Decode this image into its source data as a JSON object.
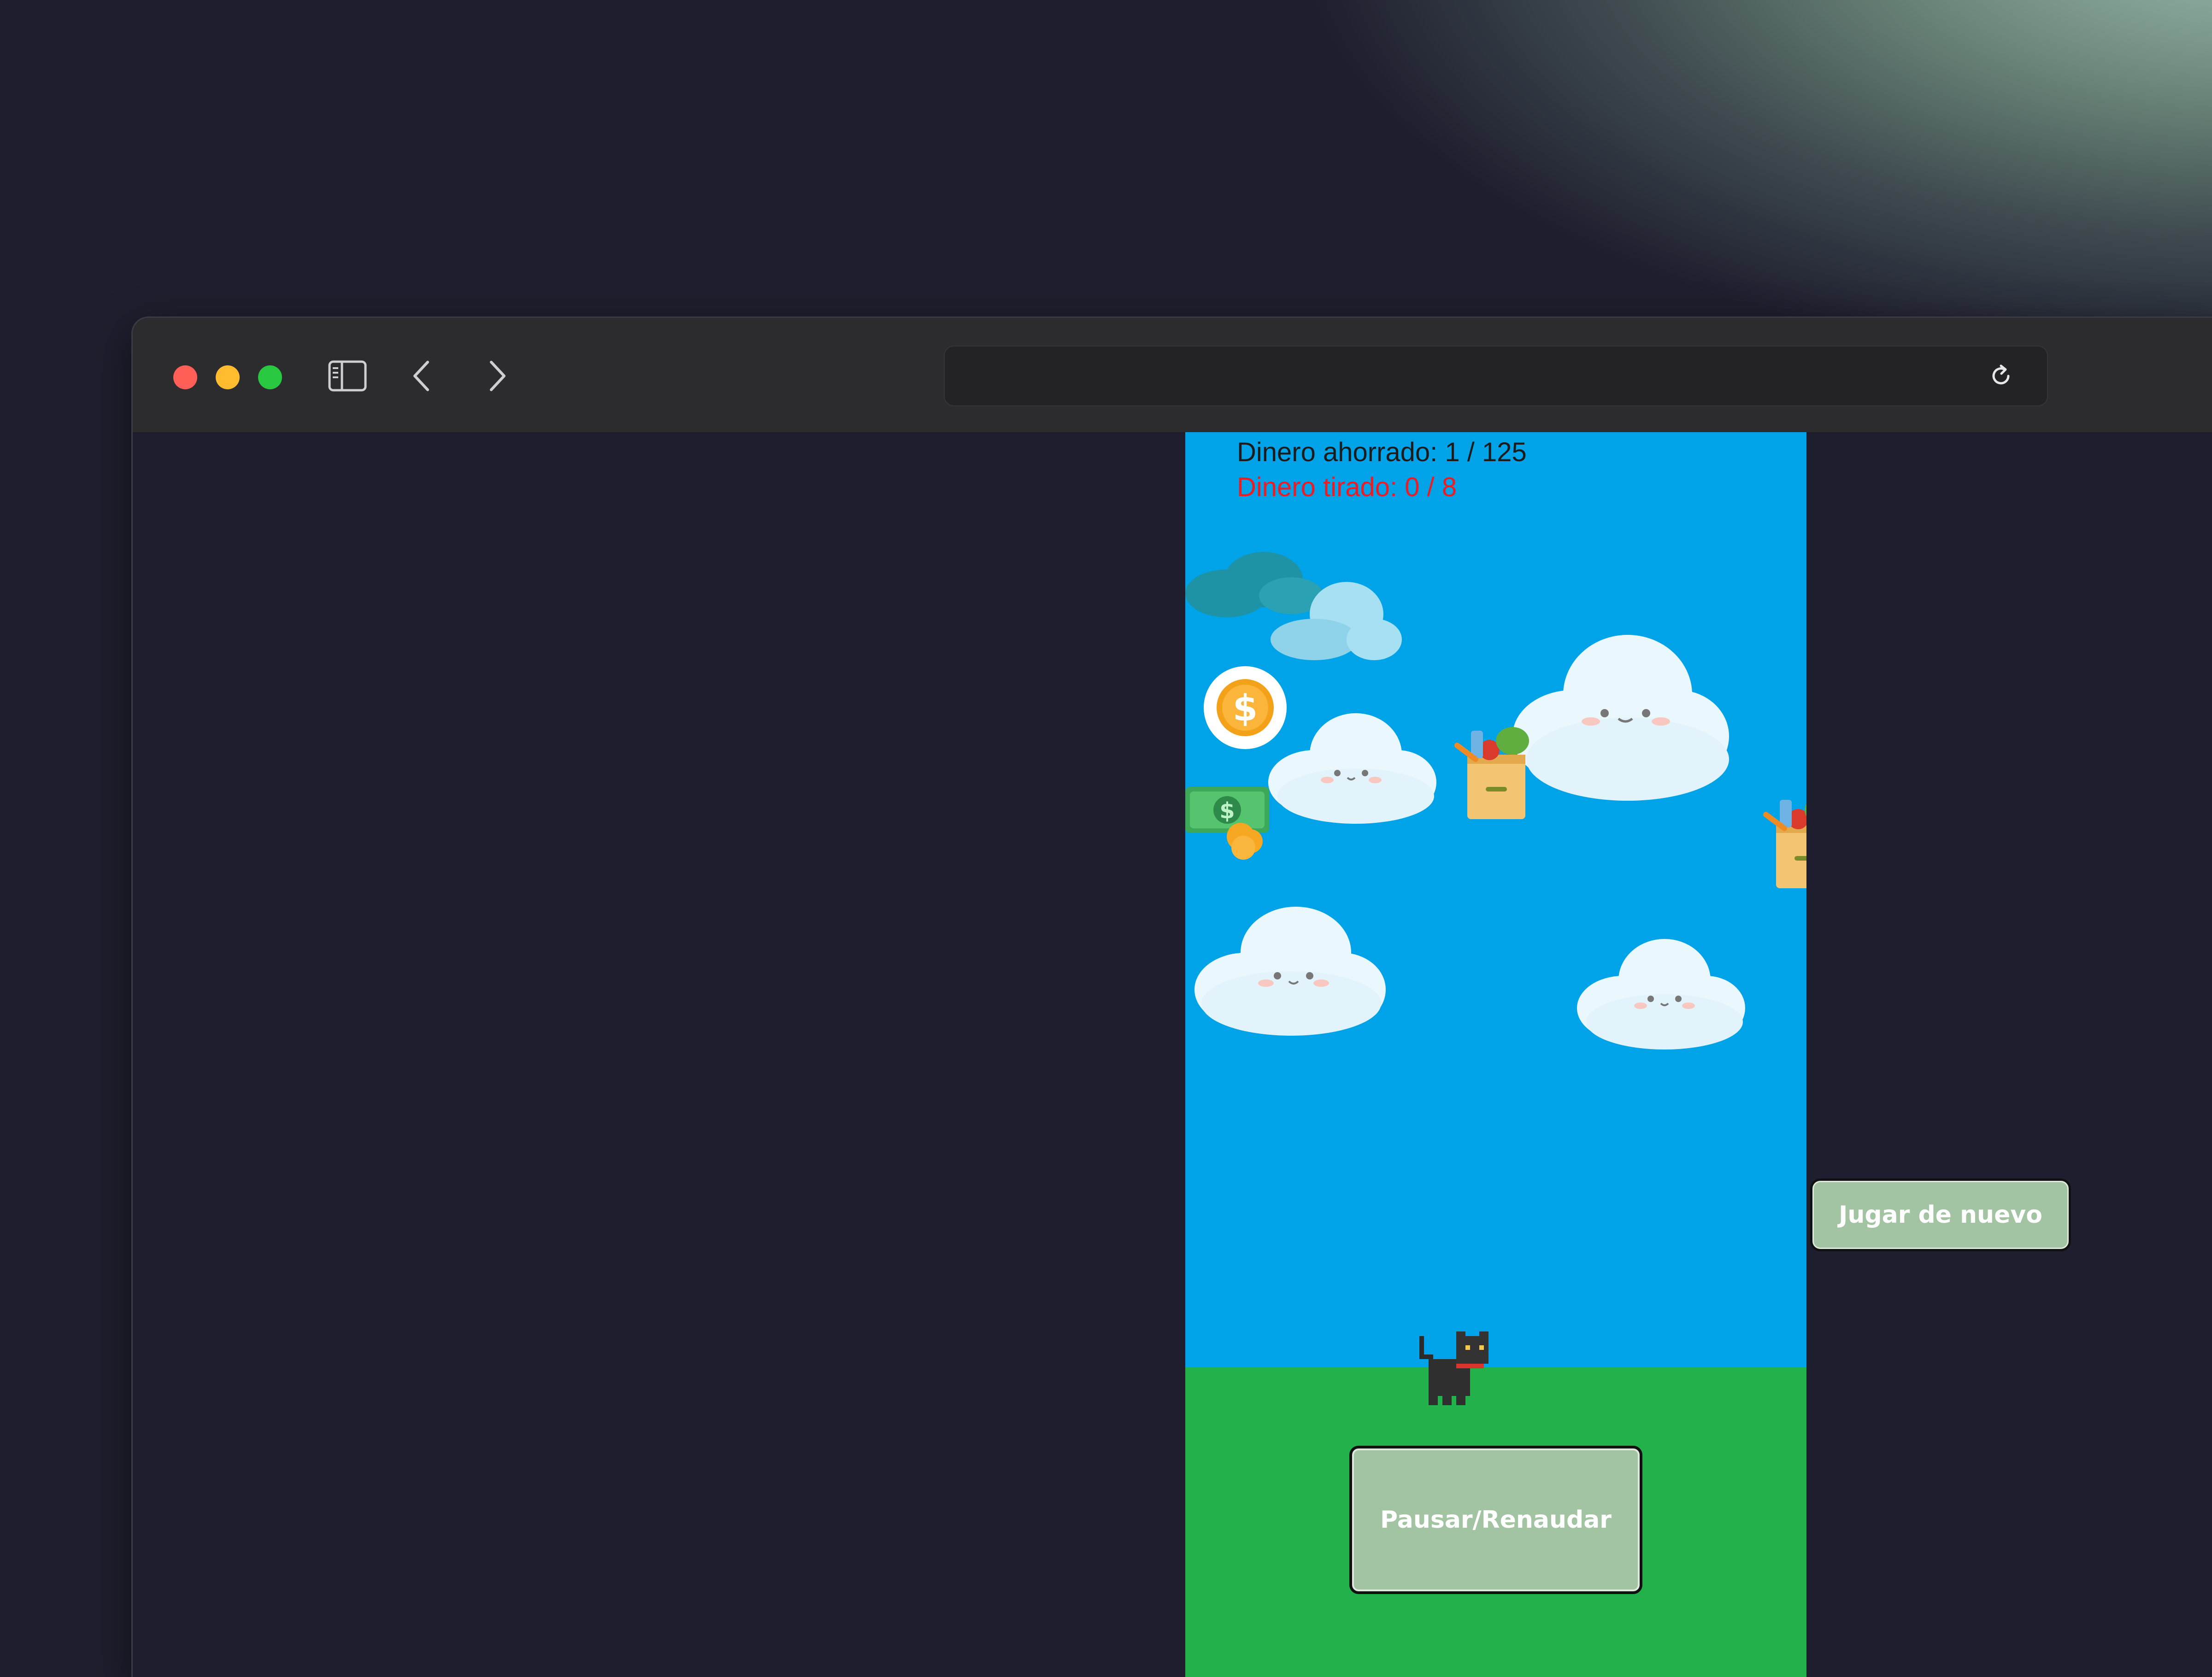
{
  "browser": {
    "url": "",
    "icons": {
      "sidebar": "sidebar-toggle-icon",
      "back": "chevron-left-icon",
      "forward": "chevron-right-icon",
      "reload": "reload-icon"
    }
  },
  "game": {
    "hud": {
      "saved_text": "Dinero ahorrado: 1 / 125",
      "thrown_text": "Dinero tirado: 0 / 8"
    },
    "buttons": {
      "pause_label": "Pausar/Renaudar",
      "replay_label": "Jugar de nuevo"
    },
    "colors": {
      "sky": "#00a3e8",
      "grass": "#23b14c",
      "button": "#a3c4a2",
      "thrown_text": "#ed1c24"
    },
    "sprites": [
      "cloud",
      "coin",
      "cash-with-coins",
      "grocery-bag",
      "black-cat"
    ]
  }
}
